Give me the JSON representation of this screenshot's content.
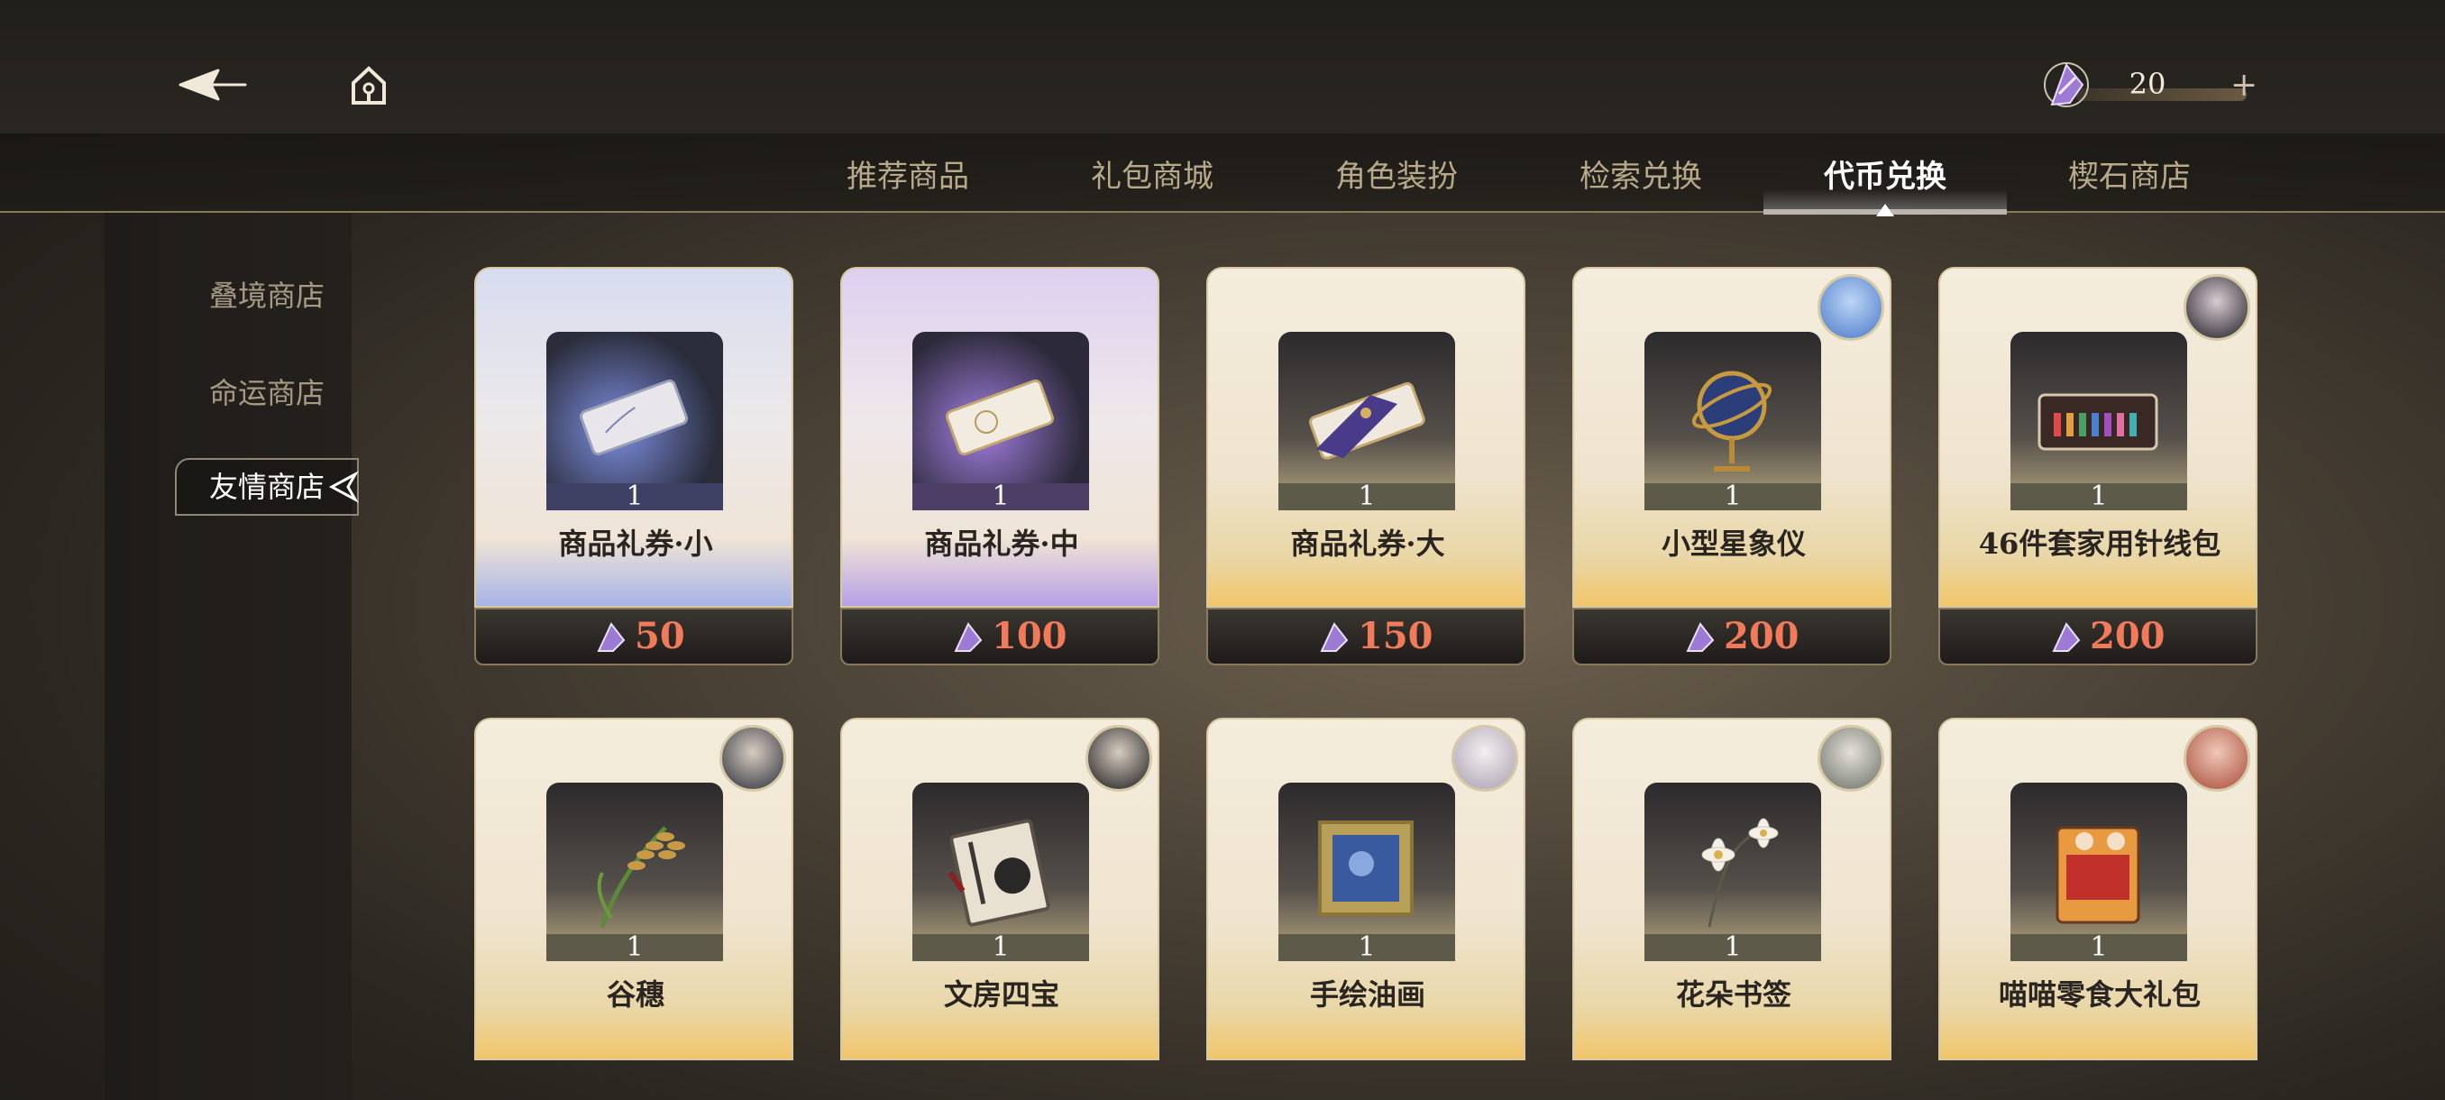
{
  "header": {
    "back_icon": "back-arrow-icon",
    "home_icon": "home-icon",
    "currency": {
      "icon": "friendship-token-icon",
      "value": "20",
      "plus": "+"
    }
  },
  "tabs": [
    {
      "label": "推荐商品",
      "active": false
    },
    {
      "label": "礼包商城",
      "active": false
    },
    {
      "label": "角色装扮",
      "active": false
    },
    {
      "label": "检索兑换",
      "active": false
    },
    {
      "label": "代币兑换",
      "active": true
    },
    {
      "label": "楔石商店",
      "active": false
    }
  ],
  "sidebar": [
    {
      "label": "叠境商店",
      "active": false
    },
    {
      "label": "命运商店",
      "active": false
    },
    {
      "label": "友情商店",
      "active": true
    }
  ],
  "items_row1": [
    {
      "name": "商品礼券·小",
      "qty": "1",
      "price": "50",
      "rarity": "blue",
      "icon": "voucher-small-icon"
    },
    {
      "name": "商品礼券·中",
      "qty": "1",
      "price": "100",
      "rarity": "purple",
      "icon": "voucher-medium-icon"
    },
    {
      "name": "商品礼券·大",
      "qty": "1",
      "price": "150",
      "rarity": "gold",
      "icon": "voucher-large-icon"
    },
    {
      "name": "小型星象仪",
      "qty": "1",
      "price": "200",
      "rarity": "gold",
      "icon": "armillary-sphere-icon"
    },
    {
      "name": "46件套家用针线包",
      "qty": "1",
      "price": "200",
      "rarity": "gold",
      "icon": "sewing-kit-icon"
    }
  ],
  "items_row2": [
    {
      "name": "谷穗",
      "qty": "1",
      "rarity": "gold",
      "icon": "rice-ear-icon"
    },
    {
      "name": "文房四宝",
      "qty": "1",
      "rarity": "gold",
      "icon": "stationery-set-icon"
    },
    {
      "name": "手绘油画",
      "qty": "1",
      "rarity": "gold",
      "icon": "oil-painting-icon"
    },
    {
      "name": "花朵书签",
      "qty": "1",
      "rarity": "gold",
      "icon": "flower-bookmark-icon"
    },
    {
      "name": "喵喵零食大礼包",
      "qty": "1",
      "rarity": "gold",
      "icon": "snack-pack-icon"
    }
  ],
  "colors": {
    "price": "#f07a5a",
    "accent": "#f1c66a"
  }
}
